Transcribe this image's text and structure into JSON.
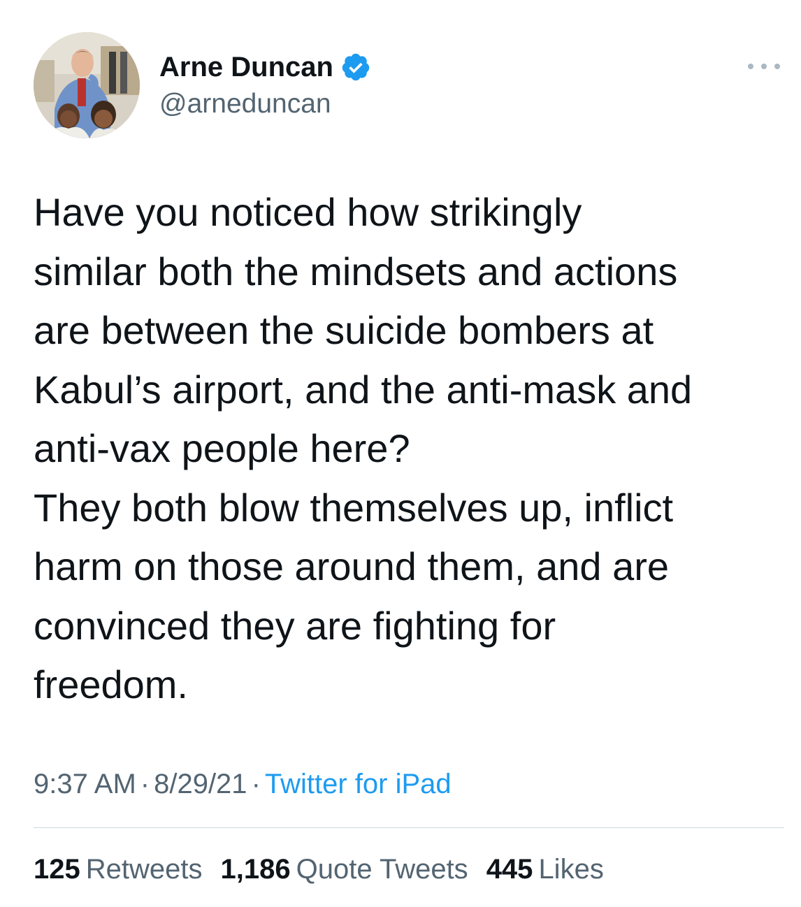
{
  "author": {
    "display_name": "Arne Duncan",
    "handle": "@arneduncan",
    "verified": true,
    "avatar_icon": "profile-photo",
    "verified_icon": "verified-badge-icon",
    "verified_color": "#1d9bf0"
  },
  "more_icon": "more-dots-icon",
  "tweet": {
    "lines": [
      "Have you noticed how strikingly",
      "similar both the mindsets and actions",
      "are between the suicide bombers at",
      "Kabul’s airport, and the anti-mask and",
      "anti-vax people here?",
      "They both blow themselves up, inflict",
      "harm on those around them, and are",
      "convinced they are fighting for",
      "freedom."
    ]
  },
  "meta": {
    "time": "9:37 AM",
    "separator": "·",
    "date": "8/29/21",
    "source": "Twitter for iPad",
    "source_color": "#1d9bf0"
  },
  "stats": {
    "retweets": {
      "count": "125",
      "label": "Retweets"
    },
    "quote_tweets": {
      "count": "1,186",
      "label": "Quote Tweets"
    },
    "likes": {
      "count": "445",
      "label": "Likes"
    }
  }
}
